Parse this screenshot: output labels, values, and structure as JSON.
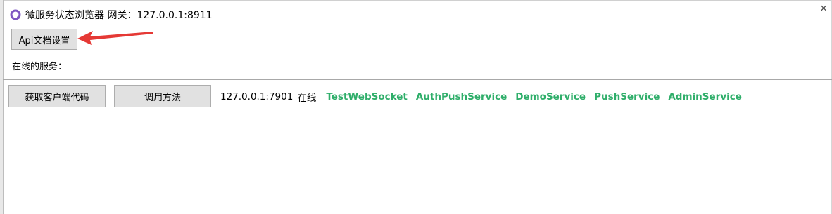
{
  "window": {
    "title": "微服务状态浏览器 网关：127.0.0.1:8911",
    "close_glyph": "×"
  },
  "toolbar": {
    "api_doc_settings_label": "Api文档设置"
  },
  "services_section": {
    "label": "在线的服务："
  },
  "service_row": {
    "get_client_code_label": "获取客户端代码",
    "invoke_method_label": "调用方法",
    "address": "127.0.0.1:7901",
    "status": "在线",
    "services": [
      "TestWebSocket",
      "AuthPushService",
      "DemoService",
      "PushService",
      "AdminService"
    ]
  },
  "colors": {
    "service_link": "#2fae6a",
    "annotation_arrow": "#e53935",
    "app_icon": "#7e57c2"
  },
  "icons": {
    "app": "app-icon",
    "annotation": "red-arrow-annotation"
  }
}
